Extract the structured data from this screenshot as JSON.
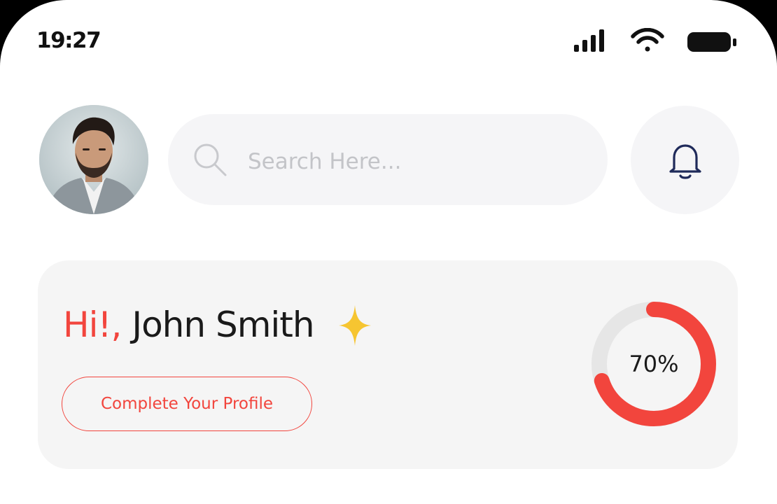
{
  "status_bar": {
    "time": "19:27",
    "icons": [
      "cellular-signal-icon",
      "wifi-icon",
      "battery-icon"
    ]
  },
  "header": {
    "avatar": "avatar",
    "search": {
      "placeholder": "Search Here...",
      "value": "",
      "icon": "search-icon"
    },
    "notification_icon": "bell-icon"
  },
  "profile_card": {
    "greeting_prefix": "Hi!,",
    "user_name": "John Smith",
    "sparkle_icon": "sparkle-icon",
    "cta_label": "Complete Your Profile",
    "progress_label": "70%",
    "progress_fraction": 0.7
  },
  "colors": {
    "accent": "#f2453d",
    "card_bg": "#f5f5f5",
    "search_bg": "#f5f5f7",
    "bell": "#1f2a5a",
    "sparkle": "#f6c531",
    "track": "#e6e6e6"
  }
}
